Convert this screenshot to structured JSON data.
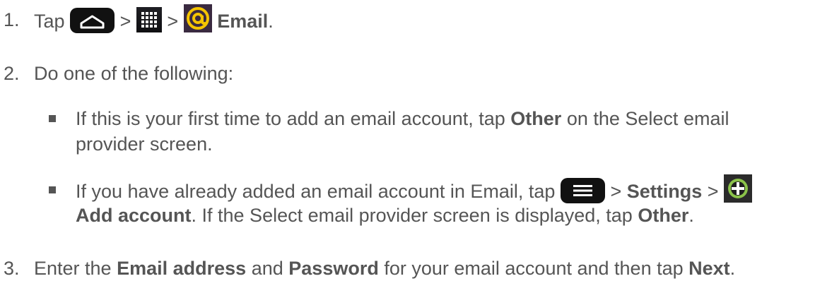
{
  "step1": {
    "num": "1.",
    "tap": "Tap",
    "gt1": ">",
    "gt2": ">",
    "email": "Email",
    "period": "."
  },
  "step2": {
    "num": "2.",
    "text": "Do one of the following:",
    "bullet1_line1_pre": "If this is your first time to add an email account, tap",
    "bullet1_other": "Other",
    "bullet1_line1_post": "on the Select email",
    "bullet1_line2": "provider screen.",
    "bullet2_line1_pre": "If you have already added an email account in Email, tap",
    "bullet2_gt1": ">",
    "bullet2_settings": "Settings",
    "bullet2_gt2": ">",
    "bullet2_add": "Add account",
    "bullet2_line2_post1": ". If the Select email provider screen is displayed, tap",
    "bullet2_other": "Other",
    "bullet2_period": "."
  },
  "step3": {
    "num": "3.",
    "pre": "Enter the",
    "email_address": "Email address",
    "and": "and",
    "password": "Password",
    "post": "for your email account and then tap",
    "next": "Next",
    "period": "."
  },
  "icons": {
    "home": "home-icon",
    "apps": "apps-grid-icon",
    "email": "email-at-icon",
    "menu": "menu-icon",
    "add": "add-plus-icon"
  },
  "colors": {
    "text": "#555555",
    "icon_dark": "#111111",
    "email_accent": "#f5c400",
    "add_green": "#8bc34a"
  }
}
